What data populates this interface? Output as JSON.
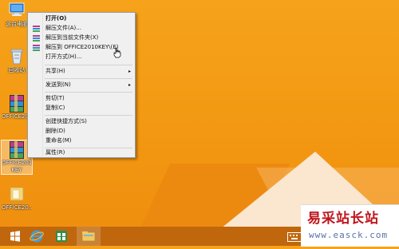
{
  "desktop": {
    "icons": [
      {
        "label": "这台电脑"
      },
      {
        "label": "回收站"
      },
      {
        "label": "OFFICE2010"
      },
      {
        "label": "OFFICE2010",
        "label2": "KEY"
      },
      {
        "label": "OFFICE20..."
      }
    ]
  },
  "context_menu": {
    "items": [
      {
        "label": "打开(O)"
      },
      {
        "label": "解压文件(A)..."
      },
      {
        "label": "解压到当前文件夹(X)"
      },
      {
        "label": "解压到 OFFICE2010KEY\\(E)"
      },
      {
        "label": "打开方式(H)..."
      },
      {
        "label": "共享(H)"
      },
      {
        "label": "发送到(N)"
      },
      {
        "label": "剪切(T)"
      },
      {
        "label": "复制(C)"
      },
      {
        "label": "创建快捷方式(S)"
      },
      {
        "label": "删除(D)"
      },
      {
        "label": "重命名(M)"
      },
      {
        "label": "属性(R)"
      }
    ],
    "submenu_arrow": "▸"
  },
  "taskbar": {
    "items": [
      "start",
      "internet-explorer",
      "store",
      "file-explorer"
    ]
  },
  "watermark": {
    "title": "易采站长站",
    "url": "www.easck.com"
  },
  "colors": {
    "desktop": "#f39a13",
    "taskbar": "#c0670d",
    "menu_bg": "#f0f0f0",
    "watermark_title": "#c0151c",
    "watermark_url": "#5a6fa8"
  }
}
